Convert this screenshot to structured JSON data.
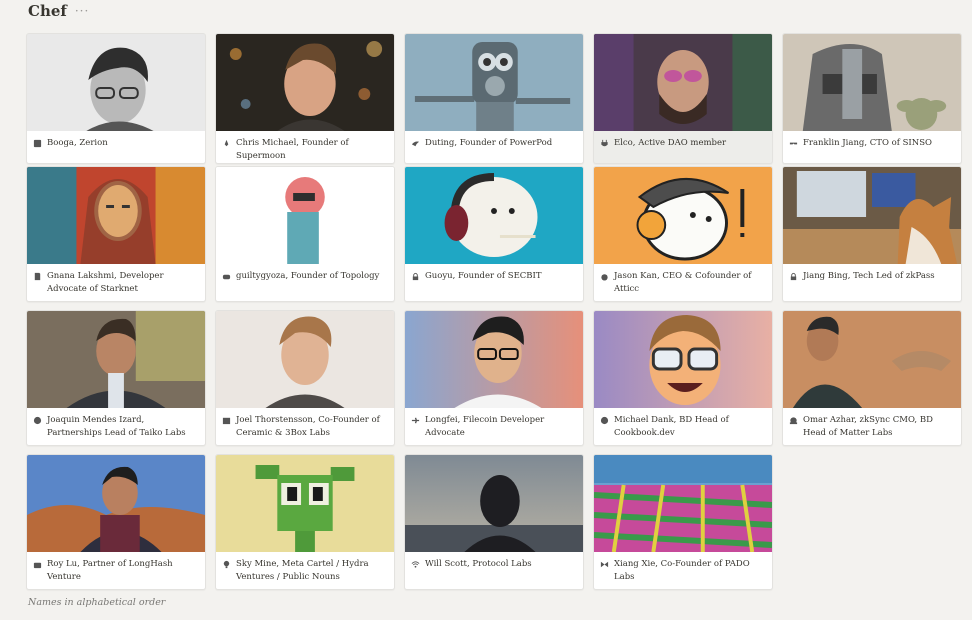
{
  "page": {
    "title": "Chef",
    "more_label": "···",
    "footnote": "Names in alphabetical order"
  },
  "cards": [
    {
      "name": "Booga, Zerion",
      "icon": "badge-icon"
    },
    {
      "name": "Chris Michael, Founder of Supermoon",
      "icon": "rocket-icon"
    },
    {
      "name": "Duting, Founder of PowerPod",
      "icon": "bird-icon"
    },
    {
      "name": "Elco, Active DAO member",
      "icon": "plug-icon"
    },
    {
      "name": "Franklin Jiang, CTO of SINSO",
      "icon": "mask-icon"
    },
    {
      "name": "Gnana Lakshmi, Developer Advocate of Starknet",
      "icon": "document-icon"
    },
    {
      "name": "guiltygyoza, Founder of Topology",
      "icon": "gamepad-icon"
    },
    {
      "name": "Guoyu, Founder of SECBIT",
      "icon": "lock-icon"
    },
    {
      "name": "Jason Kan, CEO & Cofounder of Atticc",
      "icon": "pumpkin-icon"
    },
    {
      "name": "Jiang Bing, Tech Led of zkPass",
      "icon": "lock-icon"
    },
    {
      "name": "Joaquin Mendes Izard, Partnerships Lead of Taiko Labs",
      "icon": "smiley-icon"
    },
    {
      "name": "Joel Thorstensson, Co-Founder of Ceramic & 3Box Labs",
      "icon": "calendar-icon"
    },
    {
      "name": "Longfei, Filecoin Developer Advocate",
      "icon": "airplane-icon"
    },
    {
      "name": "Michael Dank, BD Head of Cookbook.dev",
      "icon": "smiley-icon"
    },
    {
      "name": "Omar Azhar, zkSync CMO, BD Head of Matter Labs",
      "icon": "snail-icon"
    },
    {
      "name": "Roy Lu, Partner of LongHash Venture",
      "icon": "wallet-icon"
    },
    {
      "name": "Sky Mine, Meta Cartel / Hydra Ventures / Public Nouns",
      "icon": "lightbulb-icon"
    },
    {
      "name": "Will Scott, Protocol Labs",
      "icon": "wifi-icon"
    },
    {
      "name": "Xiang Xie, Co-Founder of PADO Labs",
      "icon": "butterfly-icon"
    }
  ]
}
